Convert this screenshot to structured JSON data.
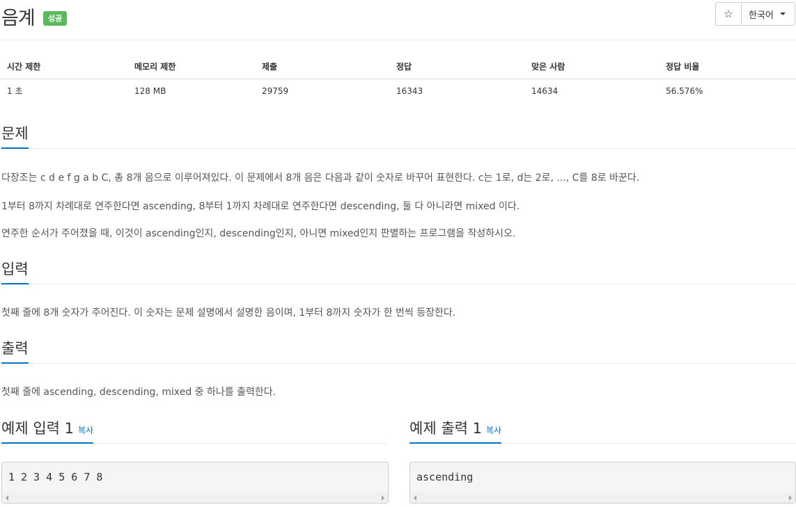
{
  "problem": {
    "title": "음계",
    "badge": "성공",
    "badge_color": "#5cb85c",
    "accent_color": "#0076c0"
  },
  "toolbar": {
    "star_icon": "☆",
    "language": "한국어"
  },
  "stats": {
    "headers": [
      "시간 제한",
      "메모리 제한",
      "제출",
      "정답",
      "맞은 사람",
      "정답 비율"
    ],
    "values": [
      "1 초",
      "128 MB",
      "29759",
      "16343",
      "14634",
      "56.576%"
    ]
  },
  "sections": {
    "description": {
      "heading": "문제",
      "paragraphs": [
        "다장조는 c d e f g a b C, 총 8개 음으로 이루어져있다. 이 문제에서 8개 음은 다음과 같이 숫자로 바꾸어 표현한다. c는 1로, d는 2로, ..., C를 8로 바꾼다.",
        "1부터 8까지 차례대로 연주한다면 ascending, 8부터 1까지 차례대로 연주한다면 descending, 둘 다 아니라면 mixed 이다.",
        "연주한 순서가 주어졌을 때, 이것이 ascending인지, descending인지, 아니면 mixed인지 판별하는 프로그램을 작성하시오."
      ]
    },
    "input": {
      "heading": "입력",
      "paragraph": "첫째 줄에 8개 숫자가 주어진다. 이 숫자는 문제 설명에서 설명한 음이며, 1부터 8까지 숫자가 한 번씩 등장한다."
    },
    "output": {
      "heading": "출력",
      "paragraph": "첫째 줄에 ascending, descending, mixed 중 하나를 출력한다."
    }
  },
  "samples": {
    "input_heading": "예제 입력 1",
    "output_heading": "예제 출력 1",
    "copy_label": "복사",
    "input_text": "1 2 3 4 5 6 7 8",
    "output_text": "ascending"
  }
}
